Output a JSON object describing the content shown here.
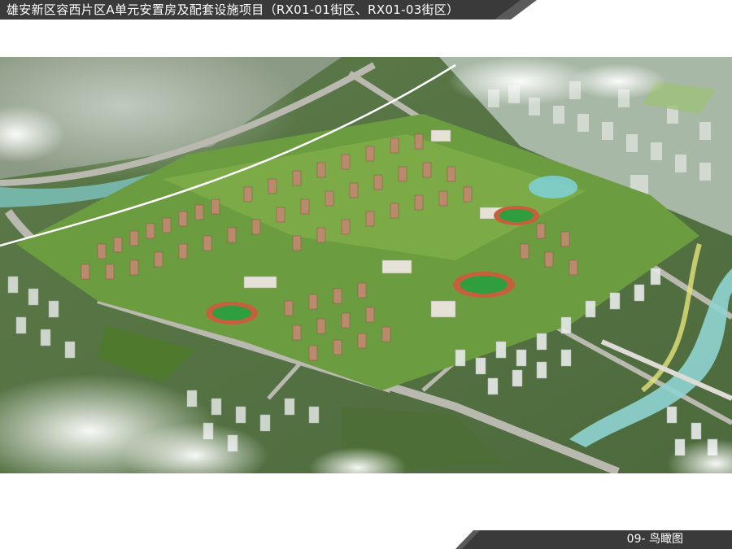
{
  "header": {
    "title": "雄安新区容西片区A单元安置房及配套设施项目（RX01-01街区、RX01-03街区）"
  },
  "footer": {
    "sheet_label": "09- 鸟瞰图"
  },
  "image": {
    "icon": "aerial-rendering"
  },
  "colors": {
    "banner": "#3a3a3a",
    "banner_accent": "#5a5a5a",
    "field": "#2e9e3e",
    "river": "#7fc9c7"
  }
}
